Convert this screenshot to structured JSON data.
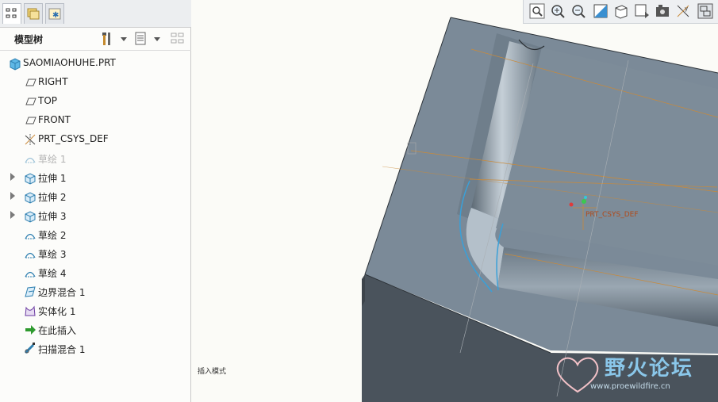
{
  "panel": {
    "title": "模型树",
    "tabs": [
      "model-tree-tab",
      "folder-browser-tab",
      "favorites-tab"
    ]
  },
  "tree": {
    "root": "SAOMIAOHUHE.PRT",
    "items": [
      {
        "label": "RIGHT",
        "icon": "datum-plane-icon",
        "expandable": false
      },
      {
        "label": "TOP",
        "icon": "datum-plane-icon",
        "expandable": false
      },
      {
        "label": "FRONT",
        "icon": "datum-plane-icon",
        "expandable": false
      },
      {
        "label": "PRT_CSYS_DEF",
        "icon": "csys-icon",
        "expandable": false
      },
      {
        "label": "草绘 1",
        "icon": "sketch-icon",
        "expandable": false,
        "dimmed": true
      },
      {
        "label": "拉伸 1",
        "icon": "extrude-icon",
        "expandable": true
      },
      {
        "label": "拉伸 2",
        "icon": "extrude-icon",
        "expandable": true
      },
      {
        "label": "拉伸 3",
        "icon": "extrude-icon",
        "expandable": true
      },
      {
        "label": "草绘 2",
        "icon": "sketch-icon",
        "expandable": false
      },
      {
        "label": "草绘 3",
        "icon": "sketch-icon",
        "expandable": false
      },
      {
        "label": "草绘 4",
        "icon": "sketch-icon",
        "expandable": false
      },
      {
        "label": "边界混合 1",
        "icon": "boundary-blend-icon",
        "expandable": false
      },
      {
        "label": "实体化 1",
        "icon": "solidify-icon",
        "expandable": false
      },
      {
        "label": "在此插入",
        "icon": "insert-here-arrow-icon",
        "expandable": false
      },
      {
        "label": "扫描混合 1",
        "icon": "swept-blend-icon",
        "expandable": false
      }
    ]
  },
  "viewport": {
    "status": "插入模式",
    "csys_label": "PRT_CSYS_DEF",
    "toolbar_icons": [
      "refit-icon",
      "zoom-in-icon",
      "zoom-out-icon",
      "repaint-icon",
      "display-style-icon",
      "saved-views-icon",
      "view-manager-icon",
      "datum-display-icon",
      "spin-center-icon"
    ]
  },
  "watermark": {
    "text": "野火论坛",
    "url": "www.proewildfire.cn"
  },
  "colors": {
    "model_face": "#7b8a98",
    "model_side": "#4a535c",
    "datum": "#c98a3a",
    "edge_highlight": "#3aa0d8"
  }
}
